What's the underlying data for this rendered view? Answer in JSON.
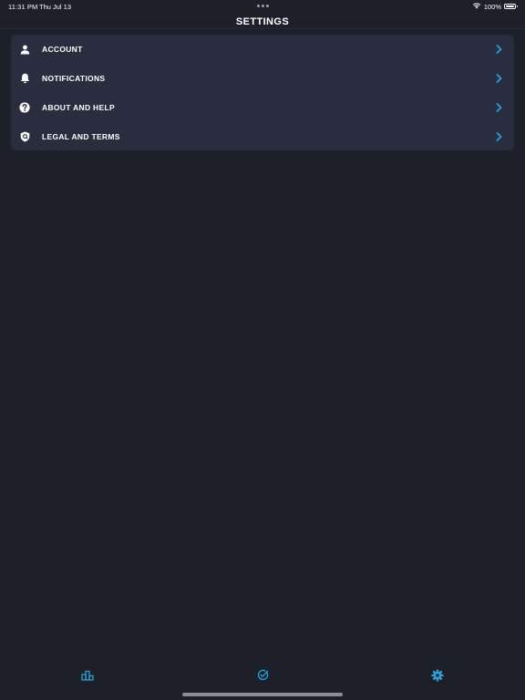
{
  "status_bar": {
    "time": "11:31 PM",
    "date": "Thu Jul 13",
    "battery": "100%"
  },
  "header": {
    "title": "SETTINGS"
  },
  "settings": {
    "items": [
      {
        "label": "ACCOUNT",
        "icon": "person-icon"
      },
      {
        "label": "NOTIFICATIONS",
        "icon": "bell-icon"
      },
      {
        "label": "ABOUT AND HELP",
        "icon": "question-circle-icon"
      },
      {
        "label": "LEGAL AND TERMS",
        "icon": "shield-icon"
      }
    ]
  },
  "tab_bar": {
    "tabs": [
      {
        "icon": "leaderboard-icon",
        "active": false
      },
      {
        "icon": "check-circle-icon",
        "active": false
      },
      {
        "icon": "gear-icon",
        "active": true
      }
    ]
  },
  "colors": {
    "background": "#1d1f29",
    "card": "#2a2d3d",
    "accent": "#2a9fd8",
    "text": "#ffffff"
  }
}
